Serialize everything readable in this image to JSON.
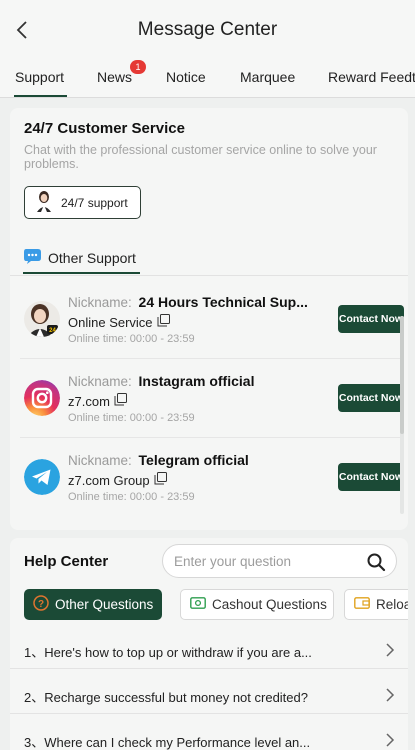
{
  "header": {
    "title": "Message Center"
  },
  "tabs": [
    {
      "label": "Support",
      "active": true
    },
    {
      "label": "News",
      "badge": "1"
    },
    {
      "label": "Notice"
    },
    {
      "label": "Marquee"
    },
    {
      "label": "Reward Feedt"
    }
  ],
  "customer_service": {
    "title": "24/7 Customer Service",
    "description": "Chat with the professional customer service online to solve your problems.",
    "support_button": "24/7 support"
  },
  "other_support": {
    "tab_label": "Other Support",
    "nickname_label": "Nickname:",
    "online_time_label": "Online time:",
    "contacts": [
      {
        "name": "24 Hours Technical Sup...",
        "service": "Online Service",
        "time": "00:00 - 23:59",
        "button": "Contact Now",
        "icon": "agent-avatar-icon"
      },
      {
        "name": "Instagram official",
        "service": "z7.com",
        "time": "00:00 - 23:59",
        "button": "Contact Now",
        "icon": "instagram-icon"
      },
      {
        "name": "Telegram official",
        "service": "z7.com Group",
        "time": "00:00 - 23:59",
        "button": "Contact Now",
        "icon": "telegram-icon"
      }
    ]
  },
  "help_center": {
    "title": "Help Center",
    "search_placeholder": "Enter your question",
    "chips": [
      {
        "label": "Other Questions",
        "active": true,
        "icon": "question-icon"
      },
      {
        "label": "Cashout Questions",
        "active": false,
        "icon": "cashout-icon"
      },
      {
        "label": "Reloa",
        "active": false,
        "icon": "reload-icon"
      }
    ],
    "questions": [
      {
        "text": "1、Here's how to top up or withdraw if you are a..."
      },
      {
        "text": "2、Recharge successful but money not credited?"
      },
      {
        "text": "3、Where can I check my Performance level an..."
      }
    ]
  },
  "colors": {
    "accent": "#1b4a36",
    "badge": "#e53935",
    "instagram": "#d6249f",
    "telegram": "#2aa3e0"
  }
}
